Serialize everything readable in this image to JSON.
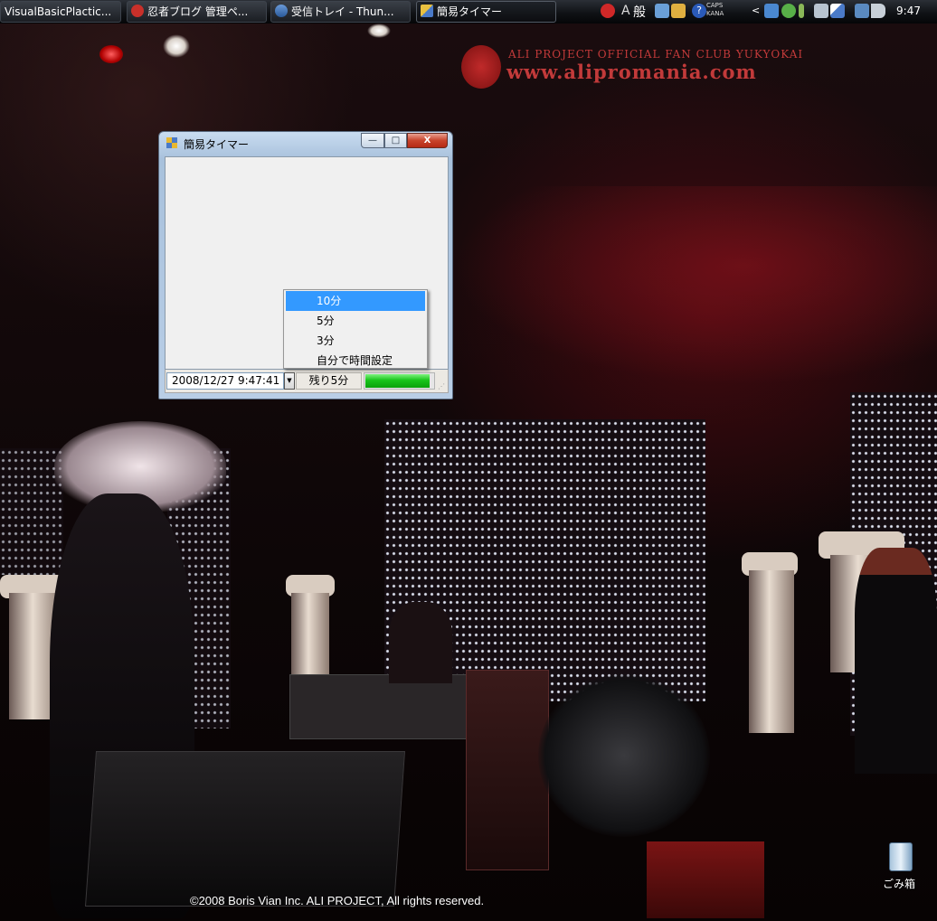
{
  "taskbar": {
    "tasks": [
      {
        "label": "VisualBasicPlactic...",
        "icon": "visual-studio-icon"
      },
      {
        "label": "忍者ブログ 管理ペ...",
        "icon": "browser-icon"
      },
      {
        "label": "受信トレイ - Thun...",
        "icon": "thunderbird-icon"
      },
      {
        "label": "簡易タイマー",
        "icon": "app-window-icon"
      }
    ],
    "tray": {
      "ime_char1": "A",
      "ime_char2": "般",
      "caps_label": "CAPS",
      "kana_label": "KANA",
      "help_glyph": "?",
      "chevron_glyph": "<",
      "clock": "9:47"
    }
  },
  "wallpaper": {
    "logo_line1": "ALI PROJECT OFFICIAL FAN CLUB YUKYOKAI",
    "logo_line2": "www.alipromania.com",
    "copyright": "©2008 Boris Vian Inc. ALI PROJECT, All rights reserved."
  },
  "desktop": {
    "recycle_bin_label": "ごみ箱"
  },
  "window": {
    "title": "簡易タイマー",
    "controls": {
      "minimize": "—",
      "maximize": "□",
      "close": "X"
    },
    "status": {
      "datetime": "2008/12/27 9:47:41",
      "dropdown_arrow": "▼",
      "remaining": "残り5分",
      "progress_fraction": 0.95,
      "grip_glyph": "⋰"
    },
    "menu": {
      "items": [
        "10分",
        "5分",
        "3分",
        "自分で時間設定"
      ],
      "selected_index": 0
    }
  },
  "colors": {
    "progress": "#17c41a",
    "menu_highlight": "#3399ff",
    "logo_red": "#c23a3a"
  }
}
